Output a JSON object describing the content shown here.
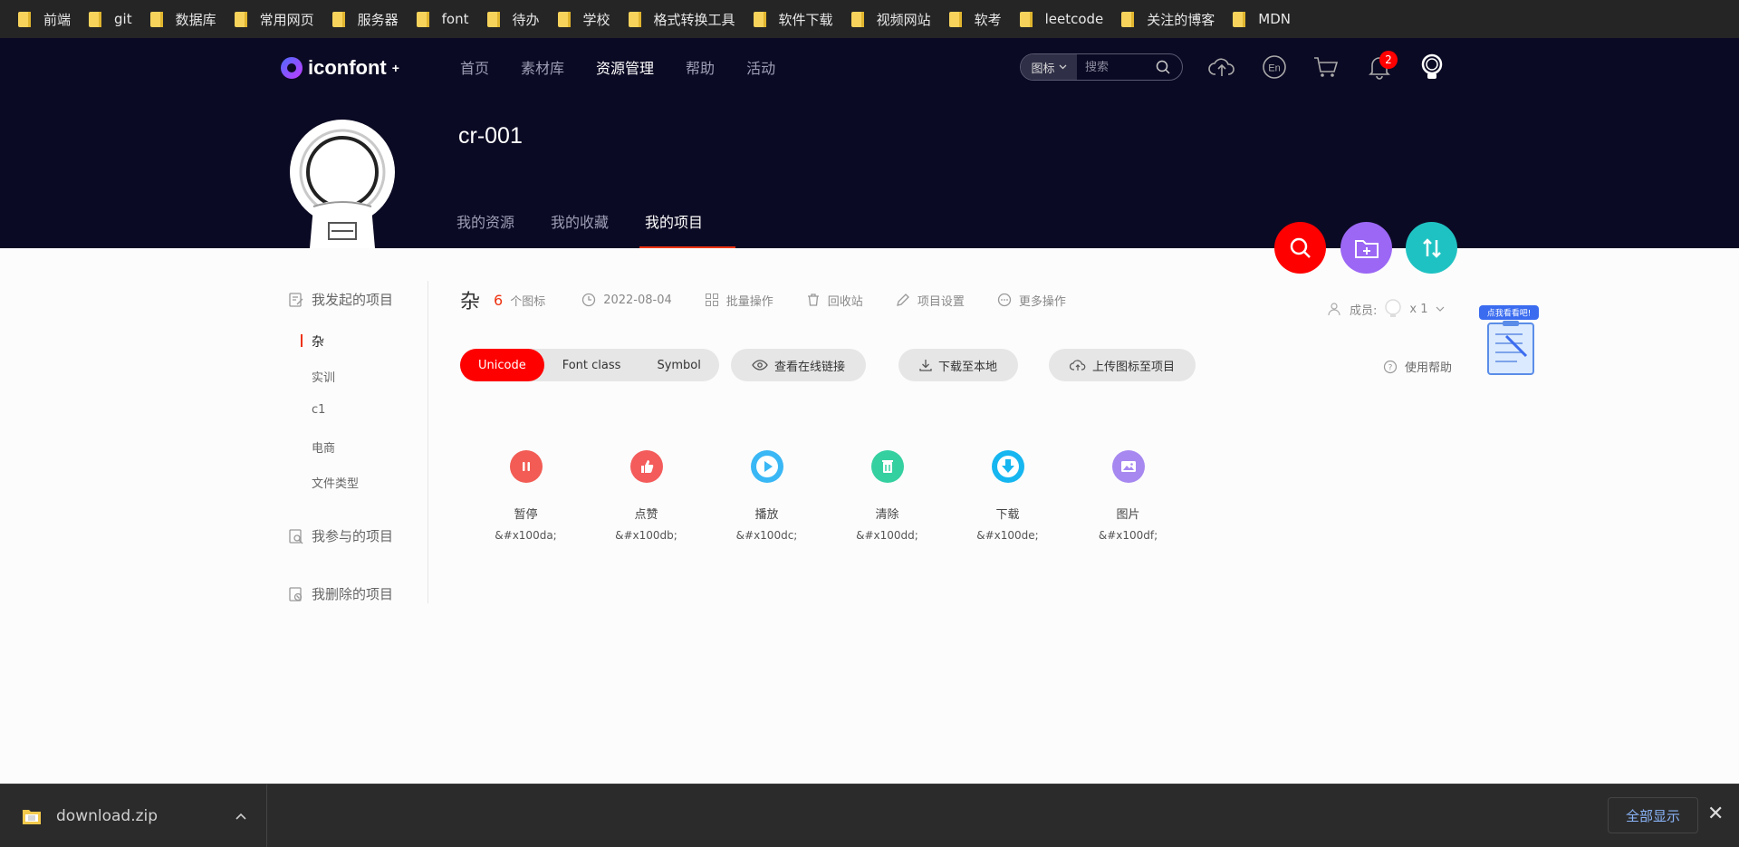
{
  "bookmarks": [
    "前端",
    "git",
    "数据库",
    "常用网页",
    "服务器",
    "font",
    "待办",
    "学校",
    "格式转换工具",
    "软件下载",
    "视频网站",
    "软考",
    "leetcode",
    "关注的博客",
    "MDN"
  ],
  "header": {
    "logo_text": "iconfont",
    "nav": [
      "首页",
      "素材库",
      "资源管理",
      "帮助",
      "活动"
    ],
    "search": {
      "type": "图标",
      "placeholder": "搜索"
    },
    "notification_count": "2",
    "project_title": "cr-001",
    "tabs": [
      "我的资源",
      "我的收藏",
      "我的项目"
    ]
  },
  "sidebar": {
    "started_label": "我发起的项目",
    "projects": [
      "杂",
      "实训",
      "c1",
      "电商",
      "文件类型"
    ],
    "joined_label": "我参与的项目",
    "deleted_label": "我删除的项目"
  },
  "main": {
    "project_name": "杂",
    "icon_count": "6",
    "icon_count_label": "个图标",
    "date": "2022-08-04",
    "actions": [
      "批量操作",
      "回收站",
      "项目设置",
      "更多操作"
    ],
    "members_label": "成员:",
    "members_count": "x 1",
    "help_label": "使用帮助",
    "helper_banner": "点我看看吧!",
    "formats": [
      "Unicode",
      "Font class",
      "Symbol"
    ],
    "buttons": [
      "查看在线链接",
      "下载至本地",
      "上传图标至项目"
    ],
    "icons": [
      {
        "name": "暂停",
        "code": "&#x100da;",
        "color": "#f25c54",
        "icon": "pause-icon"
      },
      {
        "name": "点赞",
        "code": "&#x100db;",
        "color": "#f45b5b",
        "icon": "thumbs-up-icon"
      },
      {
        "name": "播放",
        "code": "&#x100dc;",
        "color": "#3ab7f5",
        "icon": "play-icon"
      },
      {
        "name": "清除",
        "code": "&#x100dd;",
        "color": "#35d0a0",
        "icon": "trash-icon"
      },
      {
        "name": "下载",
        "code": "&#x100de;",
        "color": "#16b6f0",
        "icon": "download-icon"
      },
      {
        "name": "图片",
        "code": "&#x100df;",
        "color": "#a788f0",
        "icon": "image-icon"
      }
    ]
  },
  "downloads": {
    "file": "download.zip",
    "show_all": "全部显示"
  },
  "colors": {
    "header_bg": "#0b0a24",
    "accent": "#ff0000",
    "fab_search": "#ff0000",
    "fab_add": "#9b67f4",
    "fab_sort": "#1fc2c2"
  }
}
